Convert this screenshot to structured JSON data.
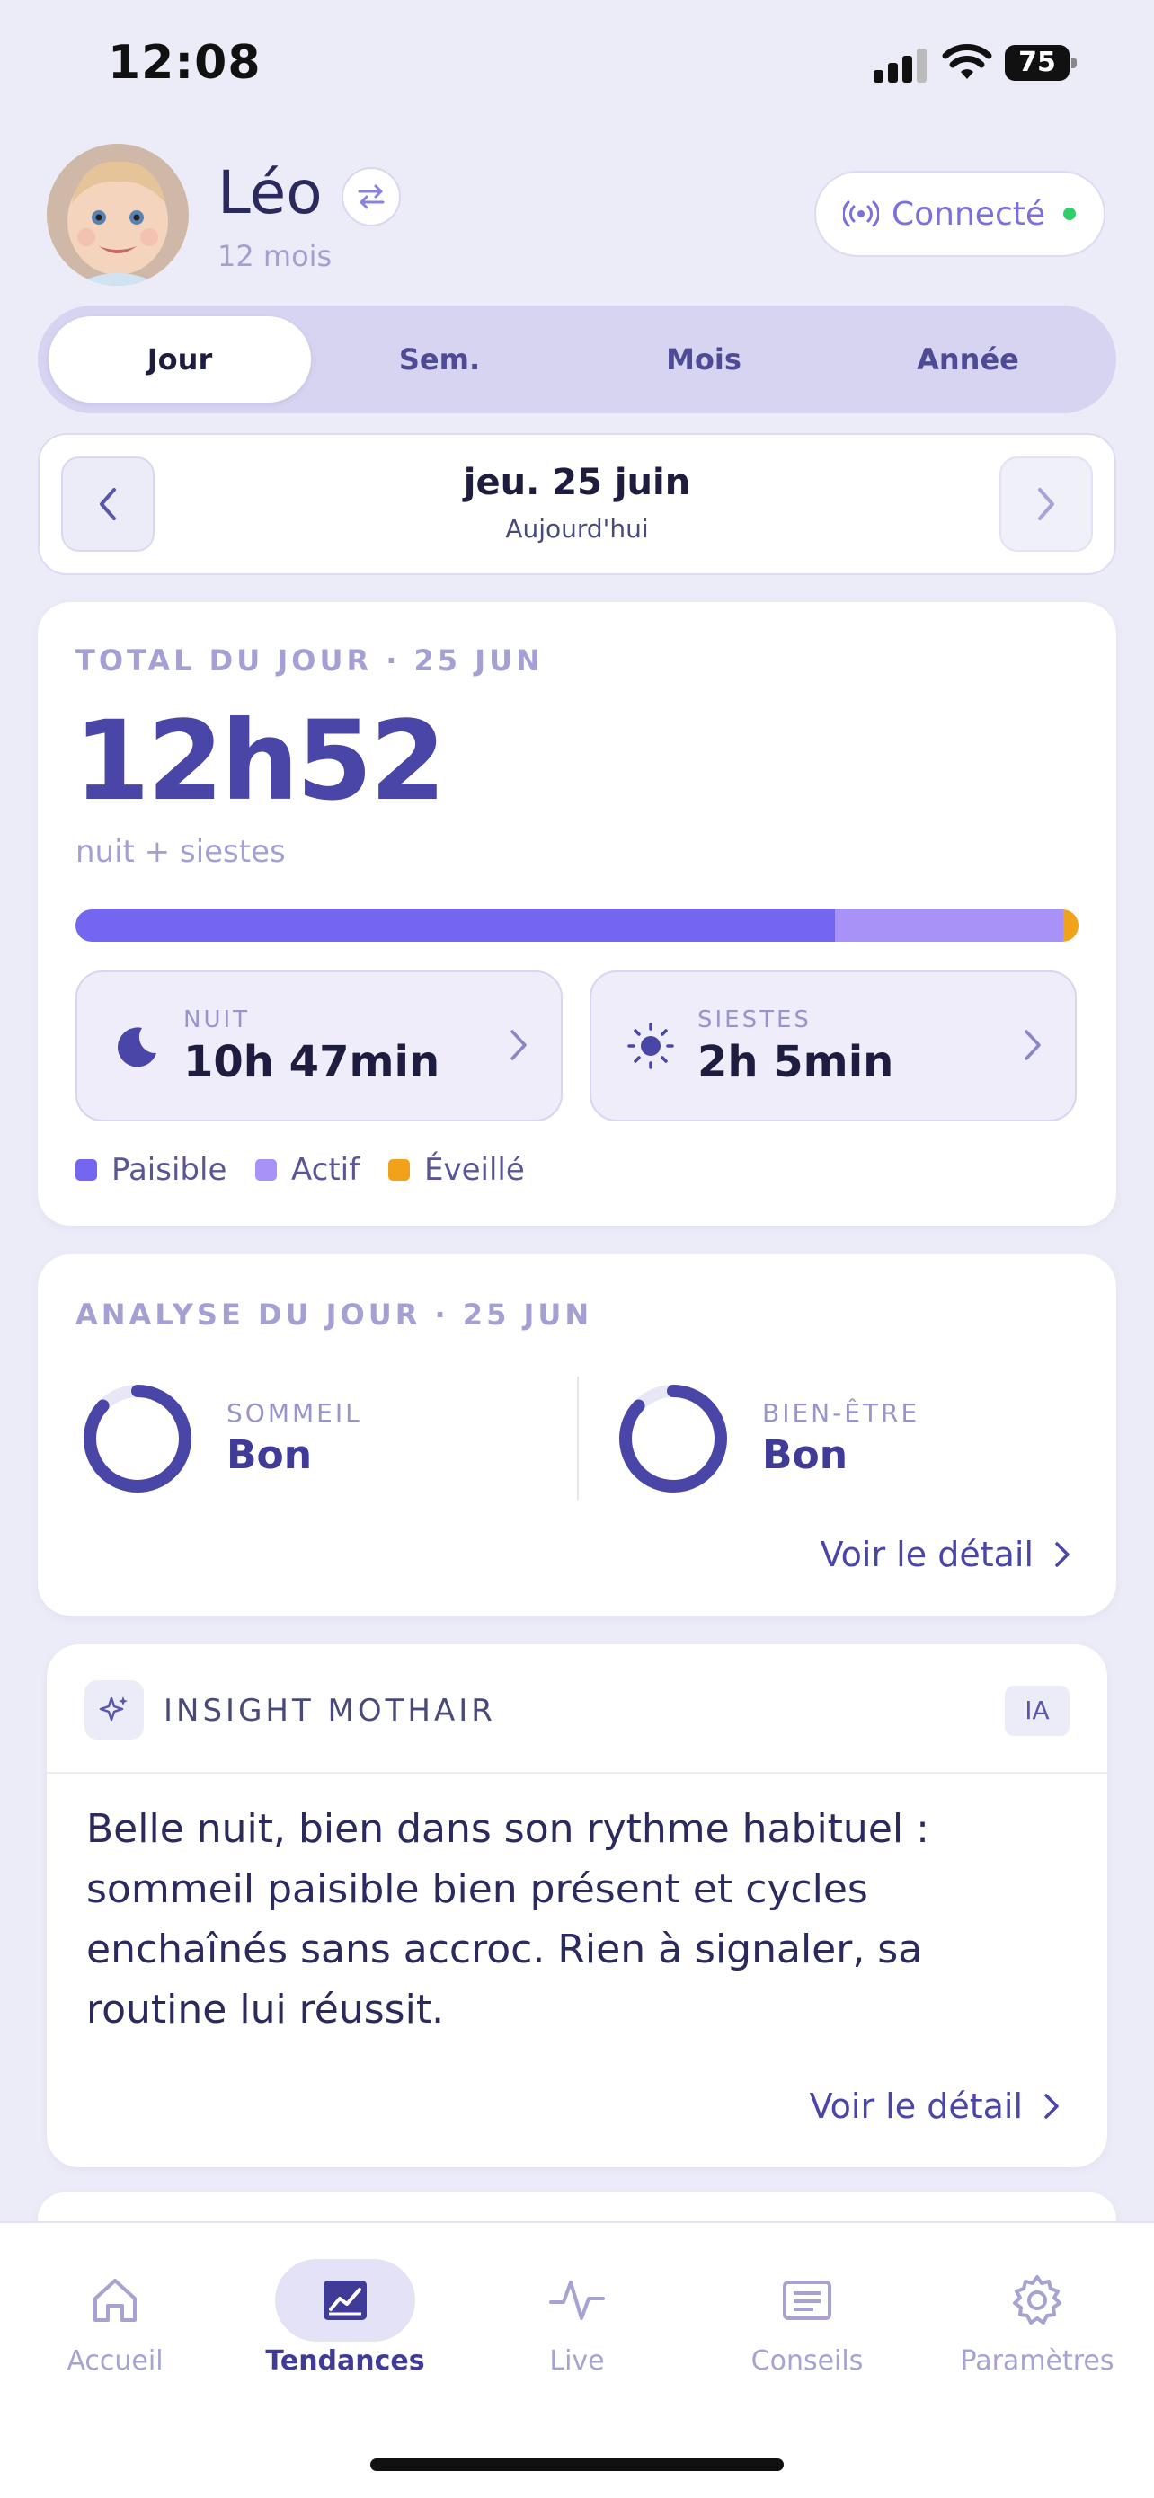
{
  "status_bar": {
    "time": "12:08",
    "battery": "75"
  },
  "profile": {
    "name": "Léo",
    "age": "12 mois",
    "connection_label": "Connecté"
  },
  "period_tabs": [
    {
      "label": "Jour",
      "active": true
    },
    {
      "label": "Sem.",
      "active": false
    },
    {
      "label": "Mois",
      "active": false
    },
    {
      "label": "Année",
      "active": false
    }
  ],
  "date_nav": {
    "date": "jeu. 25 juin",
    "relative": "Aujourd'hui"
  },
  "total_card": {
    "title": "TOTAL DU JOUR · 25 JUN",
    "total": "12h52",
    "subtitle": "nuit + siestes",
    "bar_fractions": {
      "paisible": 0.757,
      "actif": 0.228,
      "eveille": 0.015
    },
    "night": {
      "label": "NUIT",
      "value": "10h 47min",
      "icon": "moon-icon"
    },
    "naps": {
      "label": "SIESTES",
      "value": "2h 5min",
      "icon": "sun-icon"
    },
    "legend": [
      {
        "label": "Paisible",
        "color": "#7466f0"
      },
      {
        "label": "Actif",
        "color": "#a892f7"
      },
      {
        "label": "Éveillé",
        "color": "#f2a21a"
      }
    ]
  },
  "analysis_card": {
    "title": "ANALYSE DU JOUR · 25 JUN",
    "sleep": {
      "label": "SOMMEIL",
      "value": "Bon",
      "score": 0.87
    },
    "wellbeing": {
      "label": "BIEN-ÊTRE",
      "value": "Bon",
      "score": 0.87
    },
    "detail_link": "Voir le détail"
  },
  "insight_card": {
    "title": "INSIGHT MOTHAIR",
    "badge": "IA",
    "text": "Belle nuit, bien dans son rythme habituel : sommeil paisible bien présent et cycles enchaînés sans accroc. Rien à signaler, sa routine lui réussit.",
    "detail_link": "Voir le détail"
  },
  "tab_bar": [
    {
      "label": "Accueil",
      "icon": "home-icon",
      "active": false
    },
    {
      "label": "Tendances",
      "icon": "chart-icon",
      "active": true
    },
    {
      "label": "Live",
      "icon": "pulse-icon",
      "active": false
    },
    {
      "label": "Conseils",
      "icon": "news-icon",
      "active": false
    },
    {
      "label": "Paramètres",
      "icon": "gear-icon",
      "active": false
    }
  ],
  "colors": {
    "accent": "#4a46a8",
    "background": "#ececf8",
    "connected_dot": "#2fcf6b"
  }
}
